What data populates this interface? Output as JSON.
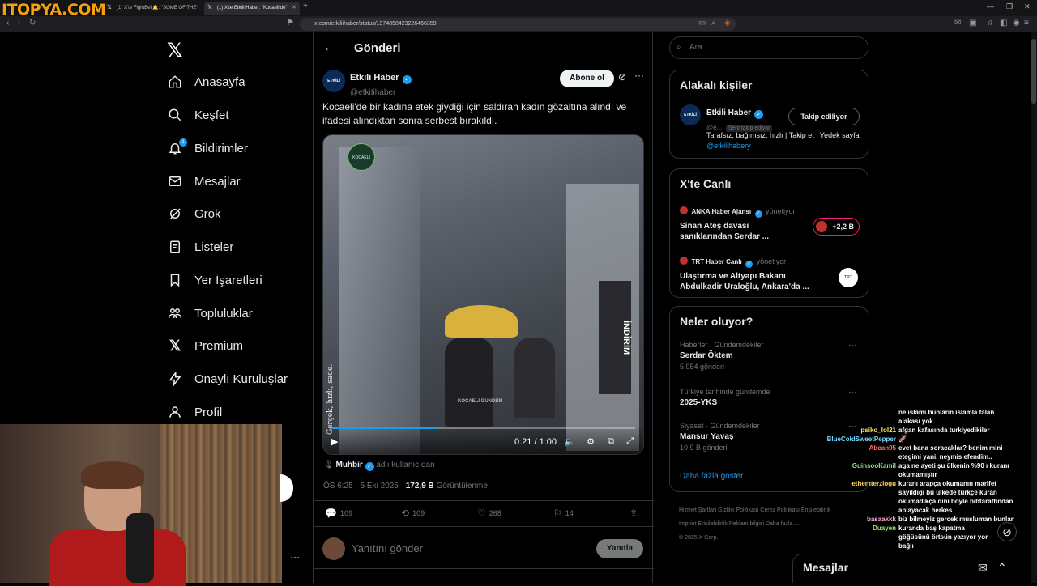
{
  "browser": {
    "overlay_logo": "ITOPYA.COM",
    "tabs": [
      {
        "label": "(1) X'te FightBell🔔: \"SOME OF THE\"",
        "active": false
      },
      {
        "label": "(1) X'te Etkili Haber: \"Kocaeli'de\"",
        "active": true
      }
    ],
    "url": "x.com/etkiliihaber/status/1974858423226466359"
  },
  "nav": {
    "items": [
      {
        "label": "Anasayfa",
        "icon": "home-icon"
      },
      {
        "label": "Keşfet",
        "icon": "search-icon"
      },
      {
        "label": "Bildirimler",
        "icon": "bell-icon",
        "badge": "1"
      },
      {
        "label": "Mesajlar",
        "icon": "mail-icon"
      },
      {
        "label": "Grok",
        "icon": "grok-icon"
      },
      {
        "label": "Listeler",
        "icon": "list-icon"
      },
      {
        "label": "Yer İşaretleri",
        "icon": "bookmark-icon"
      },
      {
        "label": "Topluluklar",
        "icon": "communities-icon"
      },
      {
        "label": "Premium",
        "icon": "x-icon"
      },
      {
        "label": "Onaylı Kuruluşlar",
        "icon": "lightning-icon"
      },
      {
        "label": "Profil",
        "icon": "person-icon"
      }
    ]
  },
  "post": {
    "header_title": "Gönderi",
    "author_name": "Etkili Haber",
    "author_handle": "@etkiIihaber",
    "subscribe_label": "Abone ol",
    "text": "Kocaeli'de bir kadına etek giydiği için saldıran kadın gözaltına alındı ve ifadesi alındıktan sonra serbest bırakıldı.",
    "video_time": "0:21 / 1:00",
    "video_watermark": "Gerçek, hızlı, sade.",
    "video_brand": "KOCAELİ GÜNDEM",
    "source_name": "Muhbir",
    "source_suffix": "adlı kullanıcıdan",
    "timestamp": "ÖS 6:25 · 5 Eki 2025 ·",
    "views": "172,9 B",
    "views_label": "Görüntülenme",
    "replies": "109",
    "reposts": "109",
    "likes": "268",
    "bookmarks": "14",
    "reply_placeholder": "Yanıtını gönder",
    "reply_button": "Yanıtla"
  },
  "right": {
    "search_placeholder": "Ara",
    "related_title": "Alakalı kişiler",
    "related": {
      "name": "Etkili Haber",
      "handle": "@e...",
      "follows_you": "Seni takip ediyor",
      "follow_button": "Takip ediliyor",
      "bio": "Tarafsız, bağımsız, hızlı | Takip et | Yedek sayfa",
      "bio_link": "@etkilihabery"
    },
    "live_title": "X'te Canlı",
    "live": [
      {
        "host": "ANKA Haber Ajansı",
        "hosting": "yönetiyor",
        "title": "Sinan Ateş davası sanıklarından Serdar ...",
        "count": "+2,2 B"
      },
      {
        "host": "TRT Haber Canlı",
        "hosting": "yönetiyor",
        "title": "Ulaştırma ve Altyapı Bakanı Abdulkadir Uraloğlu, Ankara'da ..."
      }
    ],
    "trends_title": "Neler oluyor?",
    "trends": [
      {
        "context": "Haberler · Gündemdekiler",
        "title": "Serdar Öktem",
        "count": "5.954 gönderi"
      },
      {
        "context": "Türkiye tarihinde gündemde",
        "title": "2025-YKS",
        "count": ""
      },
      {
        "context": "Siyaset · Gündemdekiler",
        "title": "Mansur Yavaş",
        "count": "10,9 B gönderi"
      }
    ],
    "show_more": "Daha fazla göster",
    "footer_line1": "Hizmet Şartları   Gizlilik Politikası   Çerez Politikası   Erişilebilirlik",
    "footer_line2": "Imprint   Erişilebilirlik   Reklam bilgisi   Daha fazla ...",
    "footer_line3": "© 2025 X Corp.",
    "messages_label": "Mesajlar"
  },
  "chat": [
    {
      "user": "",
      "msg": "ne islamı bunların islamla falan",
      "color": "#ffffff"
    },
    {
      "user": "",
      "msg": "alakası yok",
      "color": "#ffffff"
    },
    {
      "user": "psiko_lol21",
      "msg": "afgan kafasında turkiyedikiler",
      "color": "#f5e65b"
    },
    {
      "user": "BlueColdSweetPepper",
      "msg": "🚀",
      "color": "#7cd7ff"
    },
    {
      "user": "Abcan95",
      "msg": "evet bana soracaklar? benim mini",
      "color": "#ff6b6b"
    },
    {
      "user": "",
      "msg": "etegimi yani. neymis efendim..",
      "color": "#ffffff"
    },
    {
      "user": "GuinsooKamil",
      "msg": "aga ne ayeti şu ülkenin %90 ı kuranı",
      "color": "#8fe28f"
    },
    {
      "user": "",
      "msg": "okumamıştır",
      "color": "#ffffff"
    },
    {
      "user": "ethemterziogu",
      "msg": "kuranı arapça okumanın marifet",
      "color": "#ffd166"
    },
    {
      "user": "",
      "msg": "sayıldığı bu ülkede türkçe kuran",
      "color": "#ffffff"
    },
    {
      "user": "",
      "msg": "okumadıkça dini böyle bibtaraftından",
      "color": "#ffffff"
    },
    {
      "user": "",
      "msg": "anlayacak herkes",
      "color": "#ffffff"
    },
    {
      "user": "basaakkk",
      "msg": "biz bilmeyiz gercek musluman bunlar",
      "color": "#ffb0d0"
    },
    {
      "user": "Duayen",
      "msg": "kuranda baş kapatma",
      "color": "#9fe870"
    },
    {
      "user": "",
      "msg": "göğüsünü örtsün yazıyor yor",
      "color": "#ffffff"
    },
    {
      "user": "",
      "msg": "bağlı",
      "color": "#ffffff"
    }
  ]
}
